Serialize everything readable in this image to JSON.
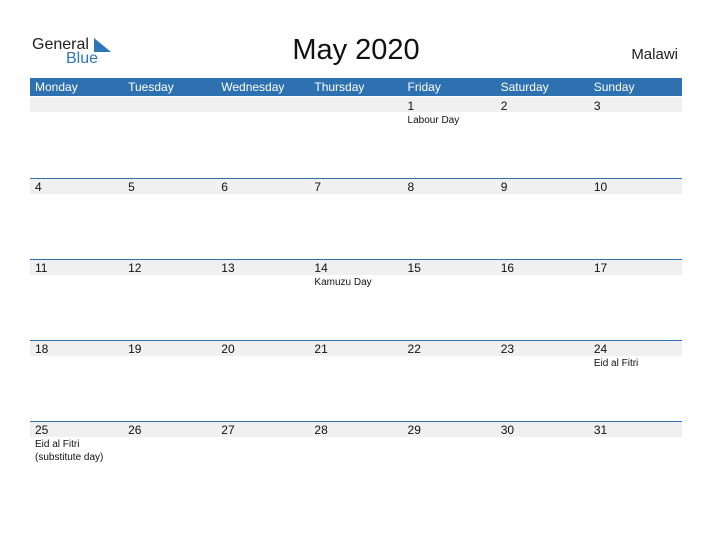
{
  "logo": {
    "line1": "General",
    "line2": "Blue"
  },
  "title": "May 2020",
  "country": "Malawi",
  "weekdays": [
    "Monday",
    "Tuesday",
    "Wednesday",
    "Thursday",
    "Friday",
    "Saturday",
    "Sunday"
  ],
  "weeks": [
    [
      {
        "d": ""
      },
      {
        "d": ""
      },
      {
        "d": ""
      },
      {
        "d": ""
      },
      {
        "d": "1",
        "ev": "Labour Day"
      },
      {
        "d": "2"
      },
      {
        "d": "3"
      }
    ],
    [
      {
        "d": "4"
      },
      {
        "d": "5"
      },
      {
        "d": "6"
      },
      {
        "d": "7"
      },
      {
        "d": "8"
      },
      {
        "d": "9"
      },
      {
        "d": "10"
      }
    ],
    [
      {
        "d": "11"
      },
      {
        "d": "12"
      },
      {
        "d": "13"
      },
      {
        "d": "14",
        "ev": "Kamuzu Day"
      },
      {
        "d": "15"
      },
      {
        "d": "16"
      },
      {
        "d": "17"
      }
    ],
    [
      {
        "d": "18"
      },
      {
        "d": "19"
      },
      {
        "d": "20"
      },
      {
        "d": "21"
      },
      {
        "d": "22"
      },
      {
        "d": "23"
      },
      {
        "d": "24",
        "ev": "Eid al Fitri"
      }
    ],
    [
      {
        "d": "25",
        "ev": "Eid al Fitri\n(substitute day)"
      },
      {
        "d": "26"
      },
      {
        "d": "27"
      },
      {
        "d": "28"
      },
      {
        "d": "29"
      },
      {
        "d": "30"
      },
      {
        "d": "31"
      }
    ]
  ]
}
